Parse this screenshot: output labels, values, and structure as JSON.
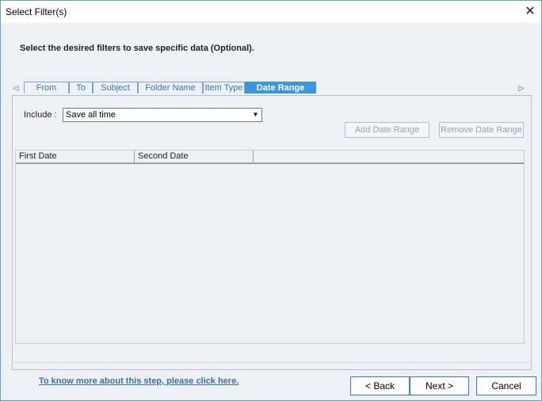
{
  "window": {
    "title": "Select Filter(s)",
    "close_glyph": "✕"
  },
  "instruction": "Select the desired filters to save specific data (Optional).",
  "tabs": [
    {
      "label": "From"
    },
    {
      "label": "To"
    },
    {
      "label": "Subject"
    },
    {
      "label": "Folder Name"
    },
    {
      "label": "Item Type"
    },
    {
      "label": "Date Range",
      "active": true
    }
  ],
  "tab_scroll": {
    "left": "◁",
    "right": "▷"
  },
  "include": {
    "label": "Include :",
    "selected": "Save all time",
    "arrow": "▼"
  },
  "buttons": {
    "add_date_range": "Add Date Range",
    "remove_date_range": "Remove Date Range",
    "back": "< Back",
    "next": "Next >",
    "cancel": "Cancel"
  },
  "grid": {
    "columns": [
      "First Date",
      "Second Date"
    ]
  },
  "help_link": "To know more about this step, please click here."
}
